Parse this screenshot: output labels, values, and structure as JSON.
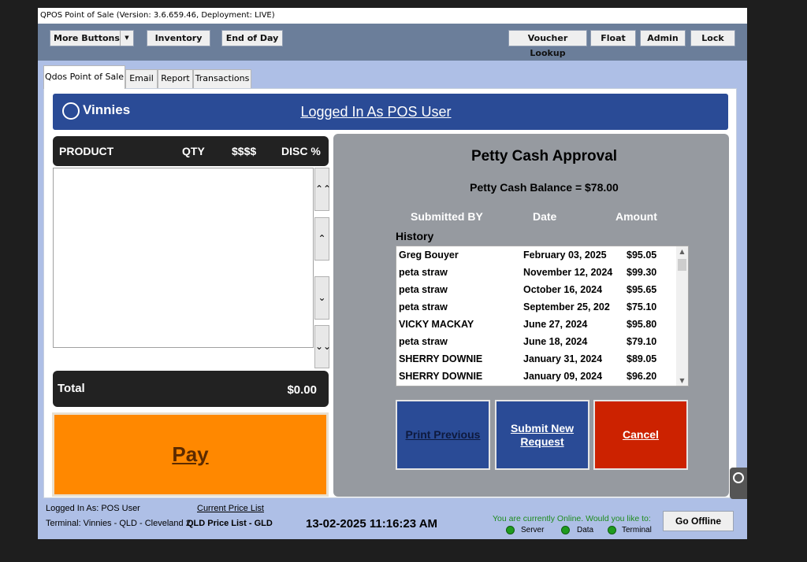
{
  "window": {
    "title": "QPOS Point of Sale (Version: 3.6.659.46, Deployment: LIVE)"
  },
  "toolbar": {
    "more_buttons": "More Buttons",
    "more_arrow": "▼",
    "inventory": "Inventory",
    "end_of_day": "End of Day",
    "voucher_lookup": "Voucher Lookup",
    "float": "Float",
    "admin": "Admin",
    "lock": "Lock"
  },
  "tabs": [
    {
      "label": "Qdos Point of Sale",
      "active": true
    },
    {
      "label": "Email",
      "active": false
    },
    {
      "label": "Report",
      "active": false
    },
    {
      "label": "Transactions",
      "active": false
    }
  ],
  "banner": {
    "logo_text": "Vinnies",
    "logged_in": "Logged In As POS User"
  },
  "product_table": {
    "headers": {
      "product": "PRODUCT",
      "qty": "QTY",
      "price": "$$$$",
      "disc": "DISC %"
    },
    "rows": []
  },
  "scroll_buttons": {
    "top": "⌃⌃",
    "up": "⌃",
    "down": "⌄",
    "bottom": "⌄⌄"
  },
  "total": {
    "label": "Total",
    "value": "$0.00"
  },
  "pay": {
    "label": "Pay"
  },
  "petty_cash": {
    "title": "Petty Cash Approval",
    "balance": "Petty Cash Balance = $78.00",
    "col_submitted": "Submitted BY",
    "col_date": "Date",
    "col_amount": "Amount",
    "history_label": "History",
    "history": [
      {
        "name": "Greg Bouyer",
        "date": "February 03, 2025",
        "amount": "$95.05"
      },
      {
        "name": "peta straw",
        "date": "November 12, 2024",
        "amount": "$99.30"
      },
      {
        "name": "peta straw",
        "date": "October 16, 2024",
        "amount": "$95.65"
      },
      {
        "name": "peta straw",
        "date": "September 25, 202",
        "amount": "$75.10"
      },
      {
        "name": "VICKY MACKAY",
        "date": "June 27, 2024",
        "amount": "$95.80"
      },
      {
        "name": "peta straw",
        "date": "June 18, 2024",
        "amount": "$79.10"
      },
      {
        "name": "SHERRY DOWNIE",
        "date": "January 31, 2024",
        "amount": "$89.05"
      },
      {
        "name": "SHERRY DOWNIE",
        "date": "January 09, 2024",
        "amount": "$96.20"
      }
    ],
    "actions": {
      "print_previous": "Print Previous",
      "submit_new": "Submit New Request",
      "cancel": "Cancel"
    },
    "colors": {
      "print_previous": "#2a4b96",
      "submit_new": "#2a4b96",
      "cancel": "#cc2200"
    }
  },
  "status_bar": {
    "logged_in": "Logged In As: POS User",
    "terminal": "Terminal: Vinnies - QLD - Cleveland 2",
    "price_list_link": "Current Price List",
    "price_list_value": "QLD Price List - GLD",
    "datetime": "13-02-2025 11:16:23 AM",
    "online_message": "You are currently Online. Would you like to:",
    "indicators": {
      "server": "Server",
      "data": "Data",
      "terminal": "Terminal"
    },
    "go_offline": "Go Offline"
  }
}
